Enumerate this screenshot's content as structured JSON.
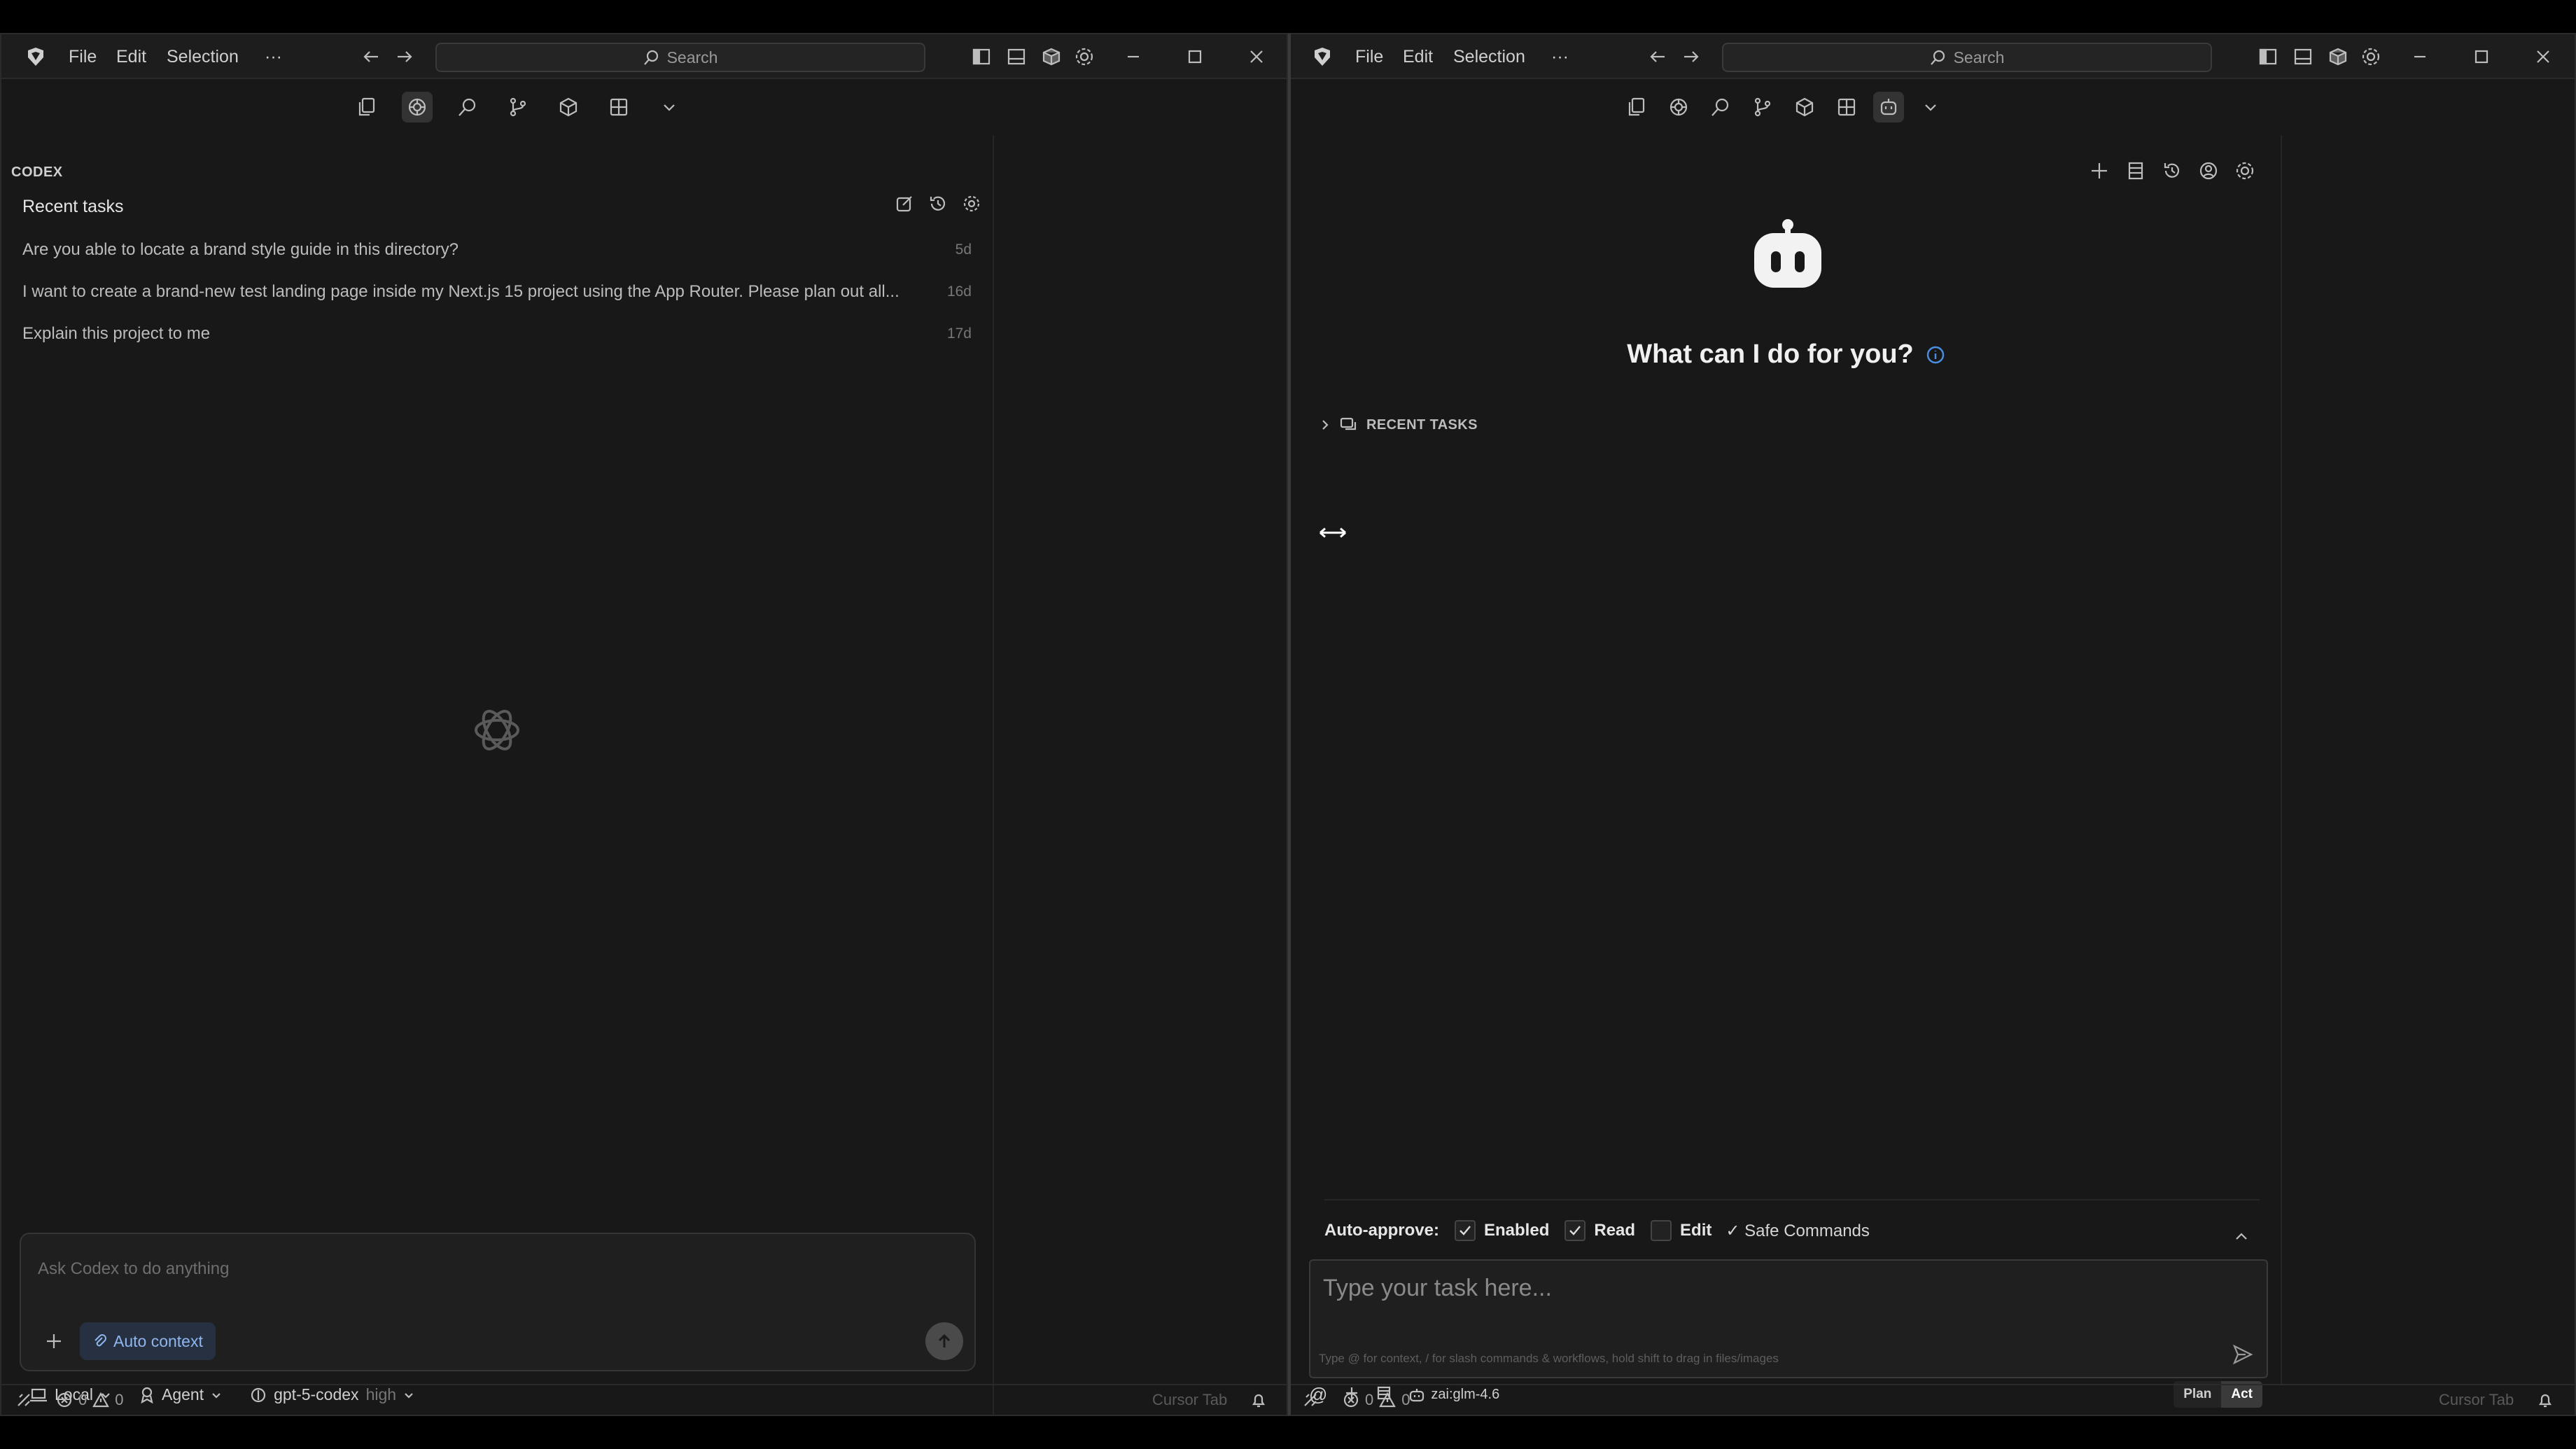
{
  "menu": [
    "File",
    "Edit",
    "Selection",
    "···"
  ],
  "search_label": "Search",
  "left": {
    "section_title": "CODEX",
    "recent_title": "Recent tasks",
    "tasks": [
      {
        "text": "Are you able to locate a brand style guide in this directory?",
        "age": "5d"
      },
      {
        "text": "I want to create a brand-new test landing page inside my Next.js 15 project using the App Router. Please plan out all...",
        "age": "16d"
      },
      {
        "text": "Explain this project to me",
        "age": "17d"
      }
    ],
    "input_placeholder": "Ask Codex to do anything",
    "auto_context": "Auto context",
    "mode_local": "Local",
    "mode_agent": "Agent",
    "model": "gpt-5-codex",
    "model_level": "high",
    "status_errors": "0",
    "status_warnings": "0",
    "status_right": "Cursor Tab"
  },
  "right": {
    "hero": "What can I do for you?",
    "recent_tasks": "RECENT TASKS",
    "auto_approve_label": "Auto-approve:",
    "approve_enabled": "Enabled",
    "approve_read": "Read",
    "approve_edit": "Edit",
    "approve_safe": "✓ Safe Commands",
    "task_placeholder": "Type your task here...",
    "task_hint": "Type @ for context, / for slash commands & workflows, hold shift to drag in files/images",
    "model": "zai:glm-4.6",
    "plan": "Plan",
    "act": "Act",
    "status_errors": "0",
    "status_warnings": "0",
    "status_right": "Cursor Tab"
  }
}
